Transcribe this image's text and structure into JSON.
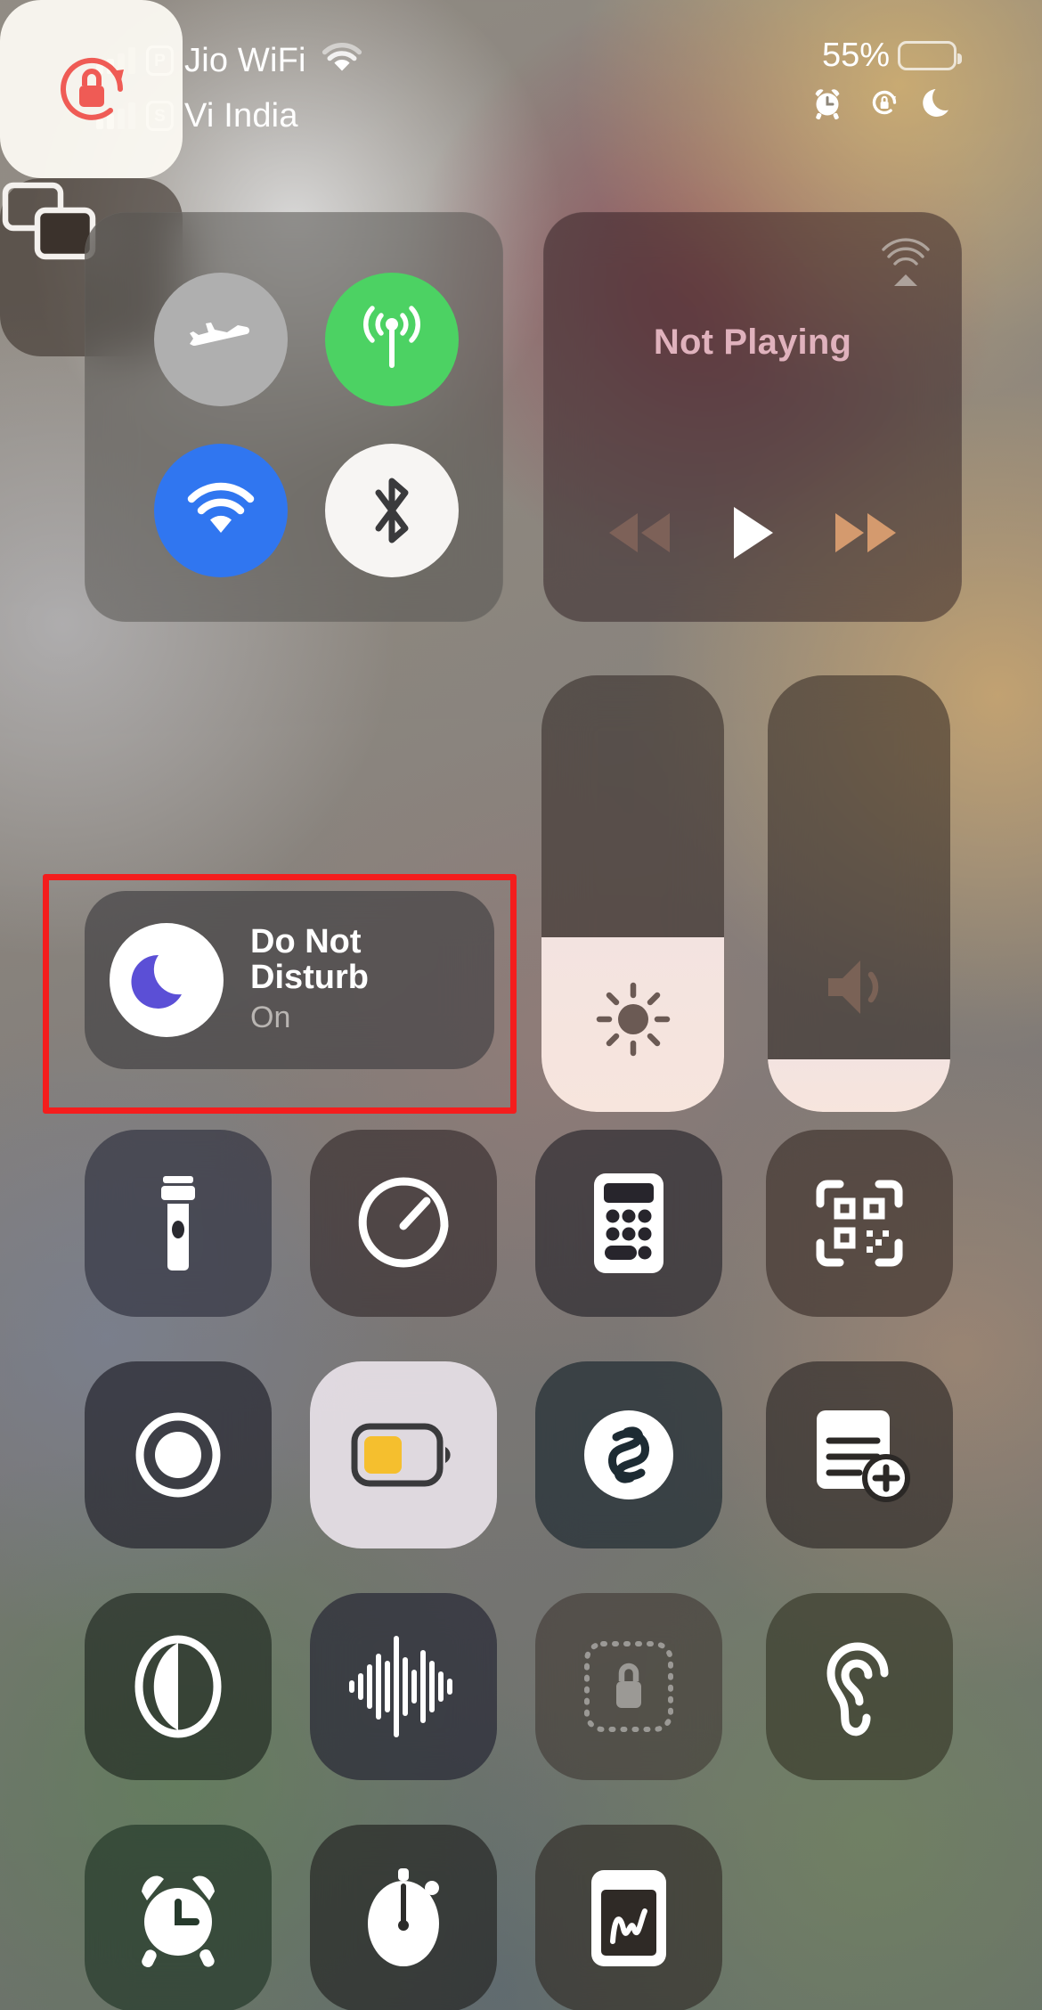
{
  "status_bar": {
    "sim_primary": {
      "badge": "P",
      "carrier": "Jio WiFi",
      "signal_bars_filled": 2,
      "wifi_icon": "wifi-icon"
    },
    "sim_secondary": {
      "badge": "S",
      "carrier": "Vi India",
      "signal_bars_filled": 2
    },
    "battery": {
      "percent_label": "55%",
      "percent_value": 55,
      "fill_color": "#f5d63d",
      "low_power_mode": true
    },
    "indicators": [
      {
        "name": "alarm-icon",
        "label": "Alarm set"
      },
      {
        "name": "rotation-lock-icon",
        "label": "Orientation lock"
      },
      {
        "name": "do-not-disturb-moon-icon",
        "label": "Do Not Disturb"
      }
    ]
  },
  "control_center": {
    "connectivity": {
      "airplane": {
        "name": "airplane-mode",
        "label": "Airplane Mode",
        "state": "Off",
        "color": "#afafaf"
      },
      "cellular": {
        "name": "cellular-data",
        "label": "Cellular Data",
        "state": "On",
        "color": "#4cd263"
      },
      "wifi": {
        "name": "wifi",
        "label": "Wi-Fi",
        "state": "On",
        "color": "#3076f0"
      },
      "bluetooth": {
        "name": "bluetooth",
        "label": "Bluetooth",
        "state": "On",
        "color": "#f7f5f3"
      }
    },
    "media": {
      "title": "Not Playing",
      "airplay_label": "AirPlay",
      "prev_label": "Rewind",
      "play_label": "Play",
      "next_label": "Fast Forward",
      "title_color": "#e0b2bd"
    },
    "rotation_lock": {
      "label": "Rotation Lock",
      "state": "On",
      "icon_color": "#ef5b55"
    },
    "screen_mirroring": {
      "label": "Screen Mirroring",
      "state": "Off"
    },
    "brightness": {
      "label": "Brightness",
      "value_percent": 40
    },
    "volume": {
      "label": "Volume",
      "value_percent": 12
    },
    "do_not_disturb": {
      "title": "Do Not Disturb",
      "state": "On",
      "moon_color": "#5b4fd6"
    },
    "highlight": {
      "target": "do-not-disturb-tile",
      "color": "#f41d1d"
    },
    "tiles": [
      {
        "name": "flashlight-tile",
        "label": "Flashlight",
        "icon": "flashlight-icon",
        "active": false,
        "tint": "rgba(40,42,56,.62)"
      },
      {
        "name": "timer-tile",
        "label": "Timer",
        "icon": "timer-icon",
        "active": false,
        "tint": "rgba(48,38,40,.62)"
      },
      {
        "name": "calculator-tile",
        "label": "Calculator",
        "icon": "calculator-icon",
        "active": false,
        "tint": "rgba(34,32,38,.62)"
      },
      {
        "name": "code-scanner-tile",
        "label": "Code Scanner",
        "icon": "qr-code-icon",
        "active": false,
        "tint": "rgba(56,44,38,.62)"
      },
      {
        "name": "screen-recording-tile",
        "label": "Screen Recording",
        "icon": "record-icon",
        "active": false,
        "tint": "rgba(30,30,40,.66)"
      },
      {
        "name": "low-power-mode-tile",
        "label": "Low Power Mode",
        "icon": "battery-low-icon",
        "active": true,
        "tint": "rgba(232,226,232,.92)"
      },
      {
        "name": "music-recognition-tile",
        "label": "Music Recognition",
        "icon": "shazam-icon",
        "active": false,
        "tint": "rgba(26,38,46,.66)"
      },
      {
        "name": "notes-tile",
        "label": "Notes",
        "icon": "new-note-icon",
        "active": false,
        "tint": "rgba(40,36,34,.62)"
      },
      {
        "name": "dark-mode-tile",
        "label": "Dark Mode",
        "icon": "dark-mode-icon",
        "active": false,
        "tint": "rgba(26,34,28,.62)"
      },
      {
        "name": "voice-memos-tile",
        "label": "Voice Memos",
        "icon": "waveform-icon",
        "active": false,
        "tint": "rgba(34,34,48,.66)"
      },
      {
        "name": "guided-access-tile",
        "label": "Guided Access",
        "icon": "lock-dotted-icon",
        "active": false,
        "tint": "rgba(58,50,46,.55)",
        "dimmed": true
      },
      {
        "name": "hearing-tile",
        "label": "Hearing",
        "icon": "ear-icon",
        "active": false,
        "tint": "rgba(48,48,34,.60)"
      },
      {
        "name": "alarm-tile",
        "label": "Alarm",
        "icon": "alarm-clock-icon",
        "active": false,
        "tint": "rgba(28,48,34,.62)"
      },
      {
        "name": "stopwatch-tile",
        "label": "Stopwatch",
        "icon": "stopwatch-icon",
        "active": false,
        "tint": "rgba(34,34,32,.66)"
      },
      {
        "name": "magnifier-tile",
        "label": "Magnifier",
        "icon": "magnifier-card-icon",
        "active": false,
        "tint": "rgba(46,40,36,.62)"
      }
    ]
  }
}
